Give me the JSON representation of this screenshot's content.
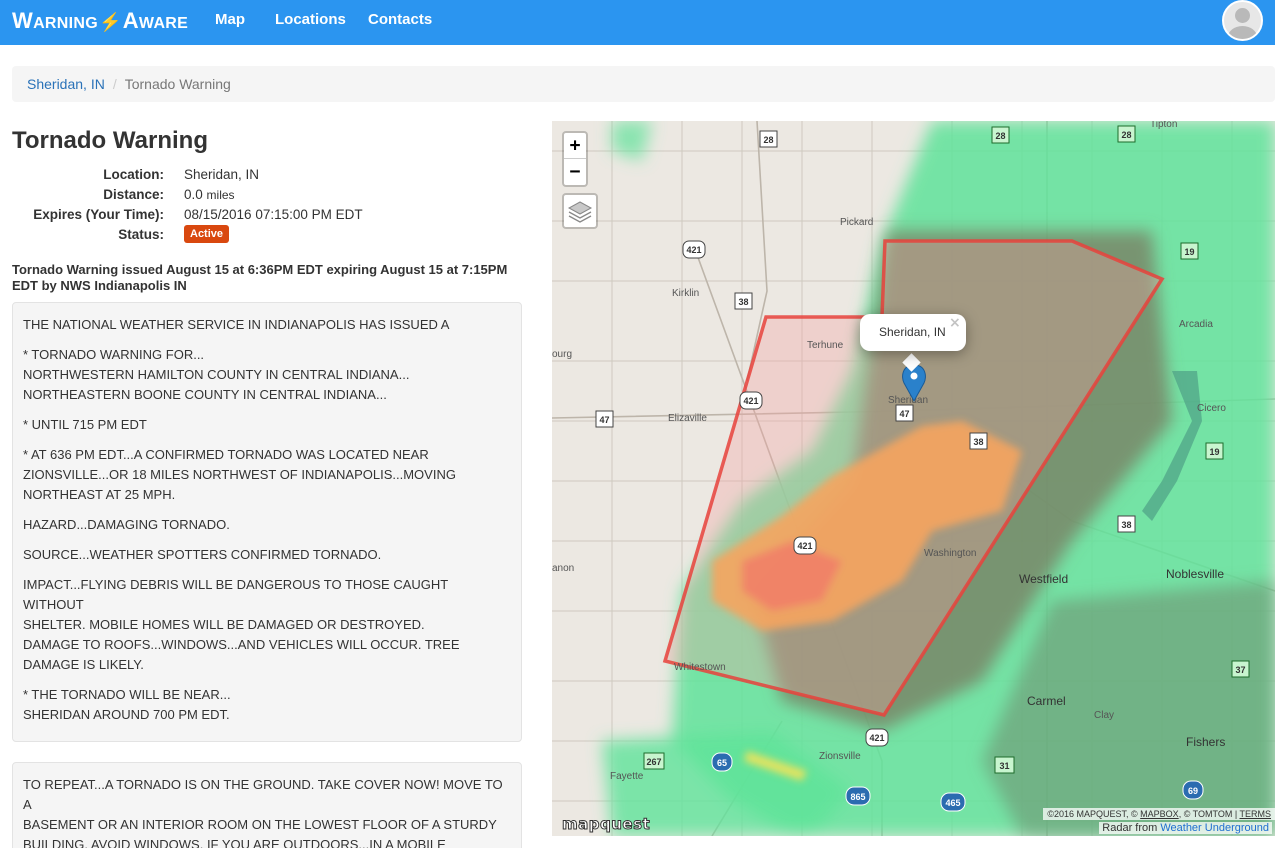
{
  "app": {
    "brand": "WARNING AWARE",
    "nav": [
      "Map",
      "Locations",
      "Contacts"
    ]
  },
  "breadcrumb": {
    "parent": "Sheridan, IN",
    "current": "Tornado Warning"
  },
  "alert": {
    "title": "Tornado Warning",
    "location_label": "Location:",
    "location_value": "Sheridan, IN",
    "distance_label": "Distance:",
    "distance_value": "0.0",
    "distance_unit": "miles",
    "expires_label": "Expires (Your Time):",
    "expires_value": "08/15/2016 07:15:00 PM EDT",
    "status_label": "Status:",
    "status_value": "Active",
    "status_color": "#d9480f",
    "headline": "Tornado Warning issued August 15 at 6:36PM EDT expiring August 15 at 7:15PM EDT by NWS Indianapolis IN"
  },
  "bulletin1": [
    "THE NATIONAL WEATHER SERVICE IN INDIANAPOLIS HAS ISSUED A",
    "* TORNADO WARNING FOR...\nNORTHWESTERN HAMILTON COUNTY IN CENTRAL INDIANA...\nNORTHEASTERN BOONE COUNTY IN CENTRAL INDIANA...",
    "* UNTIL 715 PM EDT",
    "* AT 636 PM EDT...A CONFIRMED TORNADO WAS LOCATED NEAR ZIONSVILLE...OR 18 MILES NORTHWEST OF INDIANAPOLIS...MOVING NORTHEAST AT 25 MPH.",
    "HAZARD...DAMAGING TORNADO.",
    "SOURCE...WEATHER SPOTTERS CONFIRMED TORNADO.",
    "IMPACT...FLYING DEBRIS WILL BE DANGEROUS TO THOSE CAUGHT WITHOUT\nSHELTER. MOBILE HOMES WILL BE DAMAGED OR DESTROYED.\nDAMAGE TO ROOFS...WINDOWS...AND VEHICLES WILL OCCUR. TREE DAMAGE IS LIKELY.",
    "* THE TORNADO WILL BE NEAR...\nSHERIDAN AROUND 700 PM EDT."
  ],
  "bulletin2": [
    "TO REPEAT...A TORNADO IS ON THE GROUND. TAKE COVER NOW! MOVE TO A\nBASEMENT OR AN INTERIOR ROOM ON THE LOWEST FLOOR OF A STURDY BUILDING. AVOID WINDOWS. IF YOU ARE OUTDOORS...IN A MOBILE"
  ],
  "map": {
    "zoom_in": "+",
    "zoom_out": "−",
    "popup": "Sheridan, IN",
    "popup_close": "×",
    "attribution_prefix": "©2016 MAPQUEST, © ",
    "attribution_mapbox": "MAPBOX",
    "attribution_mid": ", © TOMTOM | ",
    "attribution_terms": "TERMS",
    "radar_prefix": "Radar from ",
    "radar_source": "Weather Underground",
    "logo": "mapquest",
    "towns": [
      "Pickard",
      "Kirklin",
      "Terhune",
      "Sheridan",
      "Elizaville",
      "Arcadia",
      "Cicero",
      "Washington",
      "Westfield",
      "Noblesville",
      "Whitestown",
      "Carmel",
      "Clay",
      "Zionsville",
      "Fayette",
      "Fishers",
      "Tipton",
      "ourg",
      "anon"
    ],
    "shields": [
      "28",
      "28",
      "28",
      "421",
      "38",
      "19",
      "47",
      "421",
      "47",
      "38",
      "19",
      "38",
      "421",
      "421",
      "37",
      "267",
      "65",
      "31",
      "865",
      "465",
      "69"
    ],
    "colors": {
      "warning_polygon": "#e8423c",
      "radar_light": "#5fe39a",
      "radar_dark": "#7a7a60",
      "radar_orange": "#f7a53c",
      "marker": "#2a81cb"
    }
  }
}
